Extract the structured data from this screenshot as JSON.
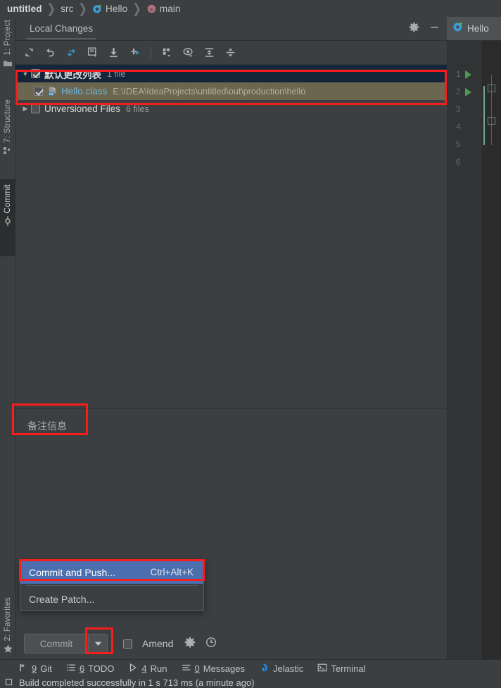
{
  "breadcrumb": {
    "items": [
      {
        "label": "untitled",
        "icon": "",
        "bold": true
      },
      {
        "label": "src",
        "icon": "",
        "bold": false
      },
      {
        "label": "Hello",
        "icon": "class-icon",
        "bold": false
      },
      {
        "label": "main",
        "icon": "method-icon",
        "bold": false
      }
    ],
    "separator": "❯"
  },
  "left_strip": {
    "tabs": [
      {
        "label": "1: Project",
        "icon": "folder-icon"
      },
      {
        "label": "7: Structure",
        "icon": "structure-icon"
      },
      {
        "label": "Commit",
        "icon": "commit-icon"
      }
    ],
    "bottom_tabs": [
      {
        "label": "2: Favorites",
        "icon": "star-icon"
      }
    ]
  },
  "tool_window": {
    "tab_label": "Local Changes",
    "header_actions": [
      {
        "name": "settings-icon",
        "glyph": "gear"
      },
      {
        "name": "hide-icon",
        "glyph": "minus"
      }
    ],
    "toolbar": [
      {
        "name": "refresh-icon",
        "tooltip": "Refresh"
      },
      {
        "name": "rollback-icon",
        "tooltip": "Rollback"
      },
      {
        "name": "show-diff-icon",
        "tooltip": "Show Diff"
      },
      {
        "name": "edit-source-icon",
        "tooltip": "Edit Source"
      },
      {
        "name": "update-project-icon",
        "tooltip": "Update Project"
      },
      {
        "name": "shelve-icon",
        "tooltip": "Shelve Silently"
      },
      {
        "name": "group-by-icon",
        "tooltip": "Group By"
      },
      {
        "name": "preview-diff-icon",
        "tooltip": "Preview Diff"
      },
      {
        "name": "expand-all-icon",
        "tooltip": "Expand All"
      },
      {
        "name": "collapse-all-icon",
        "tooltip": "Collapse All"
      }
    ],
    "tree": {
      "changelist": {
        "title": "默认更改列表",
        "count": "1 file",
        "expanded": true,
        "checked": true
      },
      "files": [
        {
          "name": "Hello.class",
          "path": "E:\\IDEA\\IdeaProjects\\untitled\\out\\production\\hello",
          "checked": true,
          "icon": "class-file-icon"
        }
      ],
      "unversioned": {
        "title": "Unversioned Files",
        "count": "6 files",
        "expanded": false,
        "checked": false
      }
    }
  },
  "commit_message": {
    "value": "备注信息"
  },
  "popup_menu": {
    "items": [
      {
        "label": "Commit and Push...",
        "shortcut": "Ctrl+Alt+K",
        "selected": true
      },
      {
        "label": "Create Patch...",
        "shortcut": "",
        "selected": false
      }
    ]
  },
  "commit_bar": {
    "commit_label": "Commit",
    "dropdown_icon": "chevron-down-icon",
    "amend_label": "Amend",
    "amend_checked": false,
    "icons": [
      {
        "name": "commit-options-gear-icon"
      },
      {
        "name": "commit-history-clock-icon"
      }
    ]
  },
  "editor": {
    "tab_label": "Hello",
    "tab_icon": "class-icon",
    "line_numbers": [
      "1",
      "2",
      "3",
      "4",
      "5",
      "6"
    ],
    "run_gutter_lines": [
      "1",
      "2"
    ]
  },
  "status_bar": {
    "items": [
      {
        "num": "9",
        "label": "Git",
        "icon": "git-branch-icon"
      },
      {
        "num": "6",
        "label": "TODO",
        "icon": "todo-list-icon"
      },
      {
        "num": "4",
        "label": "Run",
        "icon": "run-play-icon"
      },
      {
        "num": "0",
        "label": "Messages",
        "icon": "messages-icon"
      },
      {
        "num": "",
        "label": "Jelastic",
        "icon": "jelastic-icon"
      },
      {
        "num": "",
        "label": "Terminal",
        "icon": "terminal-icon"
      }
    ],
    "build_status": "Build completed successfully in 1 s 713 ms (a minute ago)"
  },
  "colors": {
    "background": "#3c3f41",
    "editor_background": "#2b2b2b",
    "selection_changelist": "#16263a",
    "selection_file": "#6b6650",
    "accent_blue": "#4b6eaf",
    "link_blue": "#6fb6d9",
    "annotation_red": "#f81d1d",
    "run_green": "#499c54"
  }
}
